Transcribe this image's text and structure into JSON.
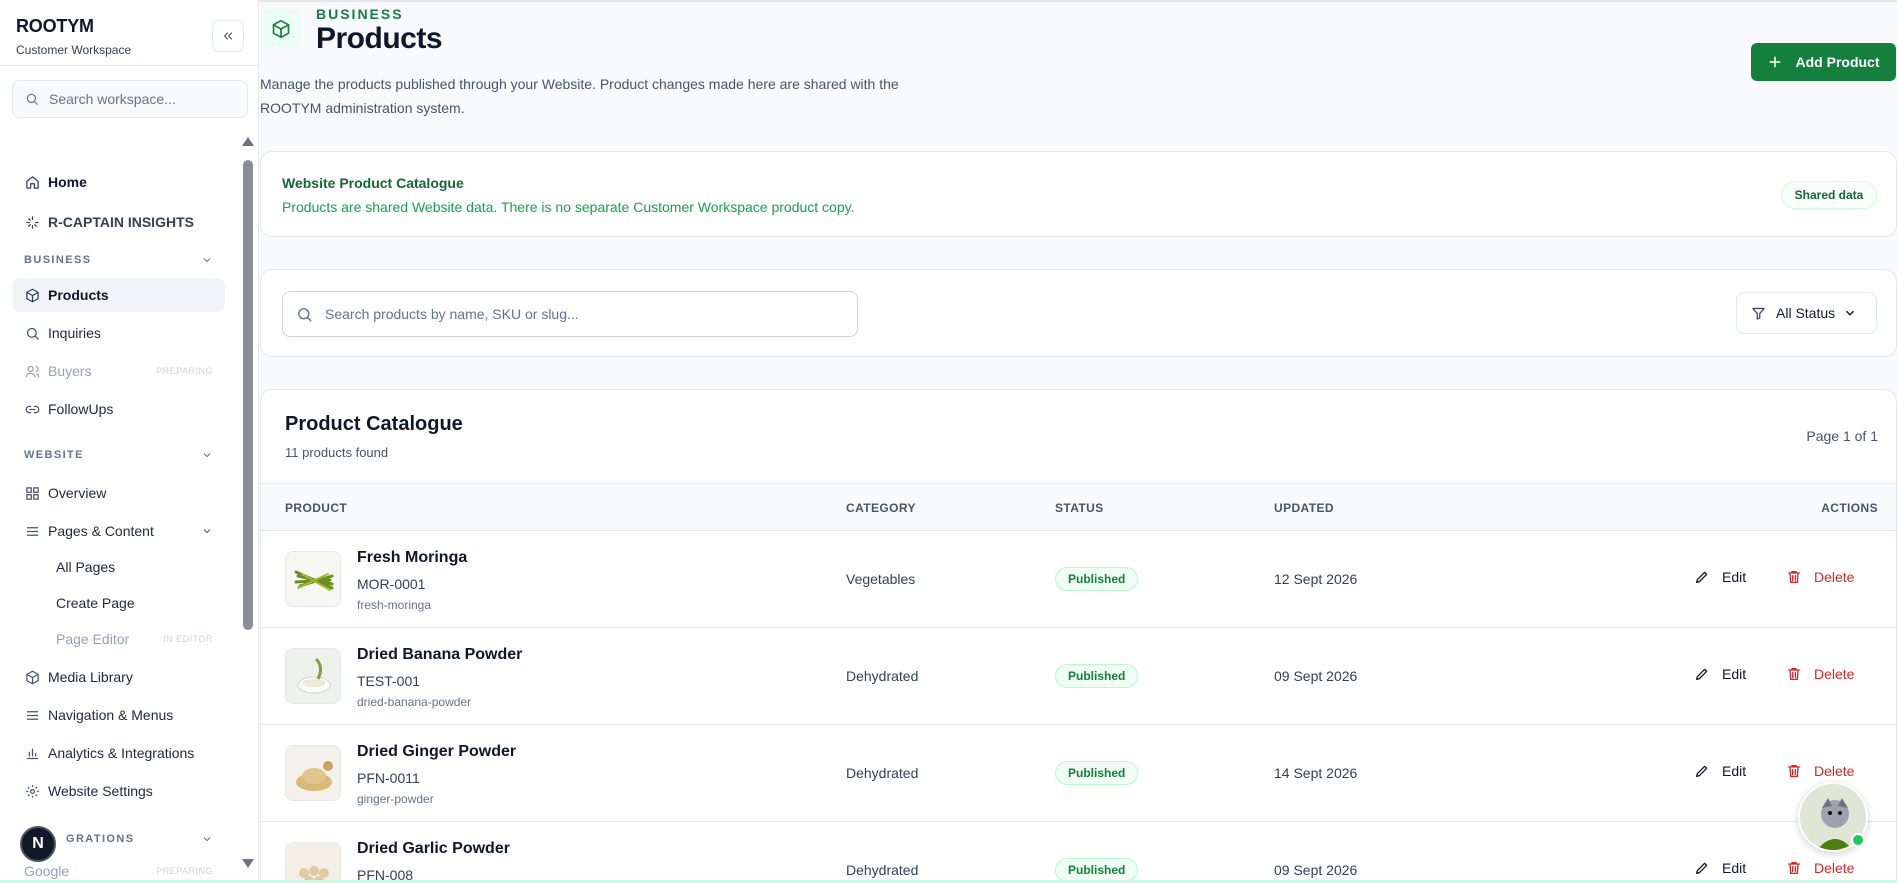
{
  "brand": {
    "name": "ROOTYM",
    "subtitle": "Customer Workspace"
  },
  "sidebar": {
    "search_placeholder": "Search workspace...",
    "top_items": [
      {
        "label": "Home",
        "icon": "home-icon"
      },
      {
        "label": "R-CAPTAIN INSIGHTS",
        "icon": "sparkles-icon"
      }
    ],
    "business": {
      "heading": "BUSINESS",
      "items": [
        {
          "label": "Products",
          "icon": "package-icon",
          "active": true
        },
        {
          "label": "Inquiries",
          "icon": "search-icon"
        },
        {
          "label": "Buyers",
          "icon": "users-icon",
          "tag": "PREPARING"
        },
        {
          "label": "FollowUps",
          "icon": "link-icon"
        }
      ]
    },
    "website": {
      "heading": "WEBSITE",
      "items": [
        {
          "label": "Overview",
          "icon": "grid-icon"
        },
        {
          "label": "Pages & Content",
          "icon": "menu-icon"
        },
        {
          "label": "All Pages"
        },
        {
          "label": "Create Page"
        },
        {
          "label": "Page Editor",
          "tag": "IN EDITOR"
        },
        {
          "label": "Media Library",
          "icon": "package-icon"
        },
        {
          "label": "Navigation & Menus",
          "icon": "menu-icon"
        },
        {
          "label": "Analytics & Integrations",
          "icon": "bar-chart-icon"
        },
        {
          "label": "Website Settings",
          "icon": "gear-icon"
        }
      ]
    },
    "integrations": {
      "heading": "GRATIONS",
      "items": [
        {
          "label": "Google",
          "tag": "PREPARING"
        }
      ]
    },
    "badge_letter": "N"
  },
  "header": {
    "eyebrow": "BUSINESS",
    "title": "Products",
    "description": "Manage the products published through your Website. Product changes made here are shared with the ROOTYM administration system.",
    "add_button": "Add Product"
  },
  "shared_notice": {
    "title": "Website Product Catalogue",
    "text": "Products are shared Website data. There is no separate Customer Workspace product copy.",
    "badge": "Shared data"
  },
  "filters": {
    "search_placeholder": "Search products by name, SKU or slug...",
    "status_label": "All Status"
  },
  "catalogue": {
    "title": "Product Catalogue",
    "count": "11 products found",
    "page": "Page 1 of 1",
    "columns": [
      "PRODUCT",
      "CATEGORY",
      "STATUS",
      "UPDATED",
      "ACTIONS"
    ],
    "edit_label": "Edit",
    "delete_label": "Delete",
    "rows": [
      {
        "name": "Fresh Moringa",
        "sku": "MOR-0001",
        "slug": "fresh-moringa",
        "category": "Vegetables",
        "status": "Published",
        "updated": "12 Sept 2026"
      },
      {
        "name": "Dried Banana Powder",
        "sku": "TEST-001",
        "slug": "dried-banana-powder",
        "category": "Dehydrated",
        "status": "Published",
        "updated": "09 Sept 2026"
      },
      {
        "name": "Dried Ginger Powder",
        "sku": "PFN-0011",
        "slug": "ginger-powder",
        "category": "Dehydrated",
        "status": "Published",
        "updated": "14 Sept 2026"
      },
      {
        "name": "Dried Garlic Powder",
        "sku": "PFN-008",
        "slug": "",
        "category": "Dehydrated",
        "status": "Published",
        "updated": "09 Sept 2026"
      }
    ]
  },
  "colors": {
    "accent": "#15803d",
    "danger": "#dc2626",
    "published_bg": "#f0fdf4"
  }
}
